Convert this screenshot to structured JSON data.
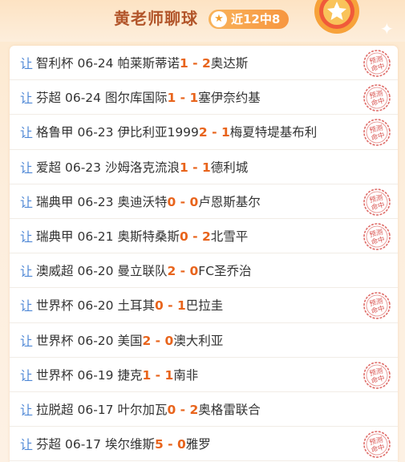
{
  "header": {
    "title": "黄老师聊球",
    "record_badge": "近12中8"
  },
  "colors": {
    "accent": "#e8641c",
    "title": "#b2552a",
    "handicap_icon": "#4f88d6",
    "stamp": "#d9534f"
  },
  "matches": [
    {
      "icon": "让",
      "league": "智利杯",
      "date": "06-24",
      "home": "帕莱斯蒂诺",
      "home_score": "1",
      "sep": " - ",
      "away_score": "2",
      "away": "奥达斯",
      "hit": true
    },
    {
      "icon": "让",
      "league": "芬超",
      "date": "06-24",
      "home": "图尔库国际",
      "home_score": "1",
      "sep": " - ",
      "away_score": "1",
      "away": "塞伊奈约基",
      "hit": true
    },
    {
      "icon": "让",
      "league": "格鲁甲",
      "date": "06-23",
      "home": "伊比利亚1999",
      "home_score": "2",
      "sep": " - ",
      "away_score": "1",
      "away": "梅夏特堤基布利",
      "hit": true
    },
    {
      "icon": "让",
      "league": "爱超",
      "date": "06-23",
      "home": "沙姆洛克流浪",
      "home_score": "1",
      "sep": " - ",
      "away_score": "1",
      "away": "德利城",
      "hit": false
    },
    {
      "icon": "让",
      "league": "瑞典甲",
      "date": "06-23",
      "home": "奥迪沃特",
      "home_score": "0",
      "sep": " - ",
      "away_score": "0",
      "away": "卢恩斯基尔",
      "hit": true
    },
    {
      "icon": "让",
      "league": "瑞典甲",
      "date": "06-21",
      "home": "奥斯特桑斯",
      "home_score": "0",
      "sep": " - ",
      "away_score": "2",
      "away": "北雪平",
      "hit": true
    },
    {
      "icon": "让",
      "league": "澳威超",
      "date": "06-20",
      "home": "曼立联队",
      "home_score": "2",
      "sep": " - ",
      "away_score": "0",
      "away": "FC圣乔治",
      "hit": false
    },
    {
      "icon": "让",
      "league": "世界杯",
      "date": "06-20",
      "home": "土耳其",
      "home_score": "0",
      "sep": " - ",
      "away_score": "1",
      "away": "巴拉圭",
      "hit": true
    },
    {
      "icon": "让",
      "league": "世界杯",
      "date": "06-20",
      "home": "美国",
      "home_score": "2",
      "sep": " - ",
      "away_score": "0",
      "away": "澳大利亚",
      "hit": false
    },
    {
      "icon": "让",
      "league": "世界杯",
      "date": "06-19",
      "home": "捷克",
      "home_score": "1",
      "sep": " - ",
      "away_score": "1",
      "away": "南非",
      "hit": true
    },
    {
      "icon": "让",
      "league": "拉脱超",
      "date": "06-17",
      "home": "叶尔加瓦",
      "home_score": "0",
      "sep": " - ",
      "away_score": "2",
      "away": "奥格雷联合",
      "hit": false
    },
    {
      "icon": "让",
      "league": "芬超",
      "date": "06-17",
      "home": "埃尔维斯",
      "home_score": "5",
      "sep": " - ",
      "away_score": "0",
      "away": "雅罗",
      "hit": true
    }
  ],
  "stamp": {
    "line1": "预测",
    "line2": "命中"
  }
}
